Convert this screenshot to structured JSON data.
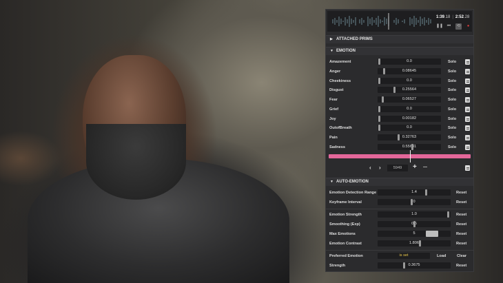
{
  "timeline": {
    "current_time": "1:39",
    "current_frac": ".18",
    "total_time": "2:52",
    "total_frac": ".28",
    "controls": [
      "pause-icon",
      "rewind-icon",
      "loop-icon",
      "record-icon"
    ]
  },
  "sections": {
    "attached_prims": "ATTACHED PRIMS",
    "emotion": "EMOTION",
    "auto_emotion": "AUTO-EMOTION"
  },
  "emotions": [
    {
      "label": "Amazement",
      "value": "0.0",
      "solo": "Solo"
    },
    {
      "label": "Anger",
      "value": "0.08645",
      "solo": "Solo"
    },
    {
      "label": "Cheekiness",
      "value": "0.0",
      "solo": "Solo"
    },
    {
      "label": "Disgust",
      "value": "0.25564",
      "solo": "Solo"
    },
    {
      "label": "Fear",
      "value": "0.06527",
      "solo": "Solo"
    },
    {
      "label": "Grief",
      "value": "0.0",
      "solo": "Solo"
    },
    {
      "label": "Joy",
      "value": "0.00182",
      "solo": "Solo"
    },
    {
      "label": "OutofBreath",
      "value": "0.0",
      "solo": "Solo"
    },
    {
      "label": "Pain",
      "value": "0.32763",
      "solo": "Solo"
    },
    {
      "label": "Sadness",
      "value": "0.55631",
      "solo": "Solo"
    }
  ],
  "keyframes": {
    "frame_number": "5949",
    "prev_label": "‹",
    "next_label": "›",
    "add_label": "+",
    "remove_label": "—"
  },
  "auto_emotion": {
    "detection_range": {
      "label": "Emotion Detection Range",
      "value": "1.4",
      "reset": "Reset"
    },
    "keyframe_interval": {
      "label": "Keyframe Interval",
      "value": "0",
      "reset": "Reset"
    },
    "strength": {
      "label": "Emotion Strength",
      "value": "1.0",
      "reset": "Reset"
    },
    "smoothing": {
      "label": "Smoothing (Exp)",
      "value": "0.5",
      "reset": "Reset"
    },
    "max_emotions": {
      "label": "Max Emotions",
      "value": "5",
      "reset": "Reset"
    },
    "contrast": {
      "label": "Emotion Contrast",
      "value": "1.806",
      "reset": "Reset"
    },
    "preferred": {
      "label": "Preferred Emotion",
      "value": "is set",
      "load": "Load",
      "clear": "Clear"
    },
    "preferred_strength": {
      "label": "Strength",
      "value": "0.3675",
      "reset": "Reset"
    }
  },
  "colors": {
    "accent_pink": "#e3679a",
    "record_red": "#d03a3a",
    "panel_bg": "#2b2b2d"
  }
}
